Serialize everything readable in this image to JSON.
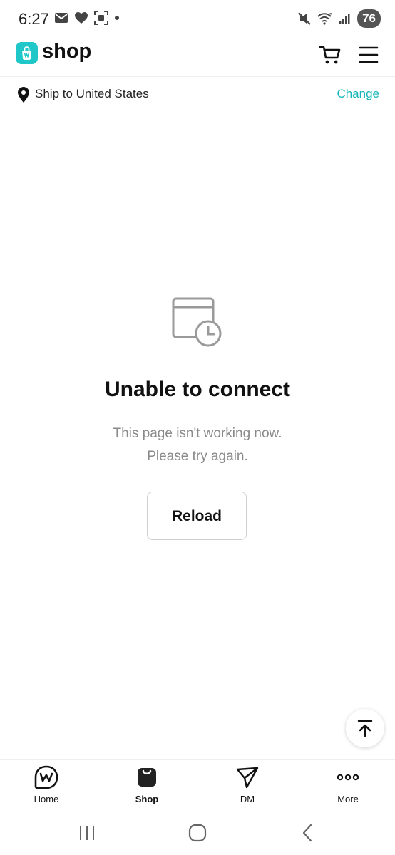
{
  "status_bar": {
    "time": "6:27",
    "battery": "76",
    "left_icons": [
      "mail-icon",
      "heart-icon",
      "screenshot-icon",
      "dot-icon"
    ],
    "right_icons": [
      "mute-icon",
      "wifi-icon",
      "signal-icon"
    ]
  },
  "header": {
    "logo_text": "shop",
    "logo_color": "#1fc7c9",
    "icons": [
      "cart-icon",
      "menu-icon"
    ]
  },
  "ship_bar": {
    "text": "Ship to United States",
    "action": "Change",
    "accent": "#16b6b8"
  },
  "error": {
    "title": "Unable to connect",
    "message_line1": "This page isn't working now.",
    "message_line2": "Please try again.",
    "button": "Reload"
  },
  "bottom_nav": {
    "items": [
      {
        "label": "Home",
        "icon": "home-w-icon"
      },
      {
        "label": "Shop",
        "icon": "shopping-bag-icon",
        "active": true
      },
      {
        "label": "DM",
        "icon": "send-icon"
      },
      {
        "label": "More",
        "icon": "more-dots-icon"
      }
    ]
  },
  "system_nav": {
    "buttons": [
      "recent-apps-icon",
      "home-circle-icon",
      "back-icon"
    ]
  }
}
